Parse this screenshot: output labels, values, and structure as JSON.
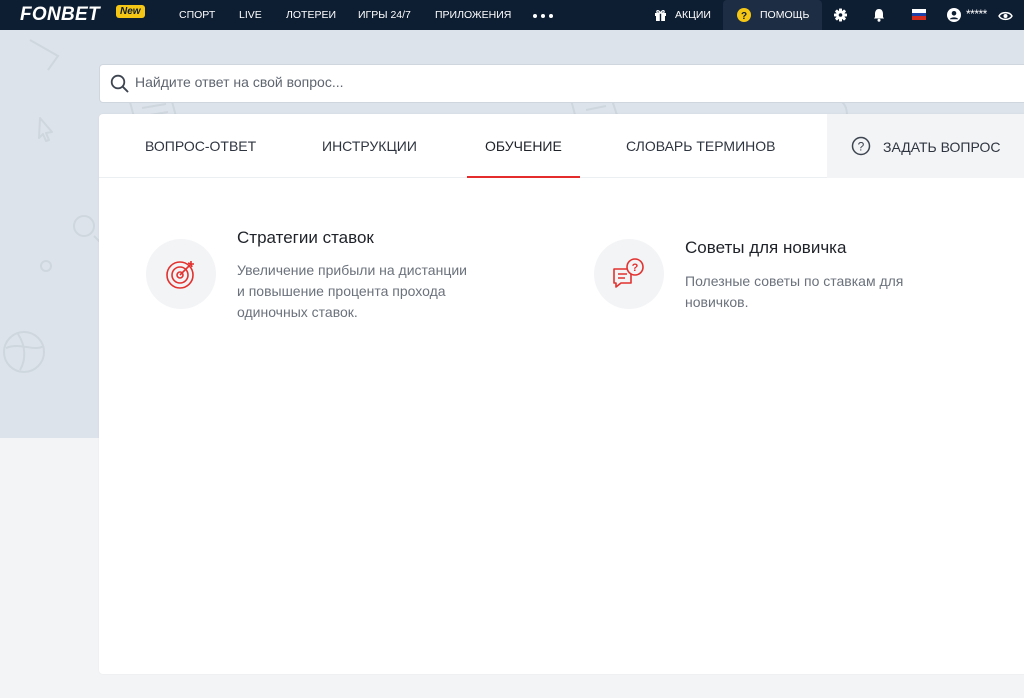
{
  "header": {
    "logo": "FONBET",
    "logo_badge": "New",
    "nav": [
      "СПОРТ",
      "LIVE",
      "ЛОТЕРЕИ",
      "ИГРЫ 24/7",
      "ПРИЛОЖЕНИЯ"
    ],
    "promotions_label": "АКЦИИ",
    "help_label": "ПОМОЩЬ",
    "account_mask": "*****",
    "flag_colors": [
      "#ffffff",
      "#1c3fa8",
      "#d52b1e"
    ],
    "icons": [
      "more-dots-icon",
      "gift-icon",
      "help-circle-icon",
      "gear-icon",
      "bell-icon",
      "russia-flag-icon",
      "user-icon",
      "eye-icon"
    ]
  },
  "search": {
    "placeholder": "Найдите ответ на свой вопрос..."
  },
  "tabs": [
    {
      "label": "ВОПРОС-ОТВЕТ",
      "active": false
    },
    {
      "label": "ИНСТРУКЦИИ",
      "active": false
    },
    {
      "label": "ОБУЧЕНИЕ",
      "active": true
    },
    {
      "label": "СЛОВАРЬ ТЕРМИНОВ",
      "active": false
    }
  ],
  "ask_button": {
    "label": "ЗАДАТЬ ВОПРОС"
  },
  "items": [
    {
      "title": "Стратегии ставок",
      "description": [
        "Увеличение прибыли на дистанции",
        "и повышение процента прохода",
        "одиночных ставок."
      ],
      "icon": "target-icon"
    },
    {
      "title": "Советы для новичка",
      "description": [
        "Полезные советы по ставкам для",
        "новичков."
      ],
      "icon": "chat-question-icon"
    }
  ],
  "colors": {
    "topbar": "#0d1d32",
    "accent": "#e52c2c",
    "badge": "#f6c615",
    "help_icon": "#f6c615",
    "hero_bg": "#dde3ea"
  }
}
